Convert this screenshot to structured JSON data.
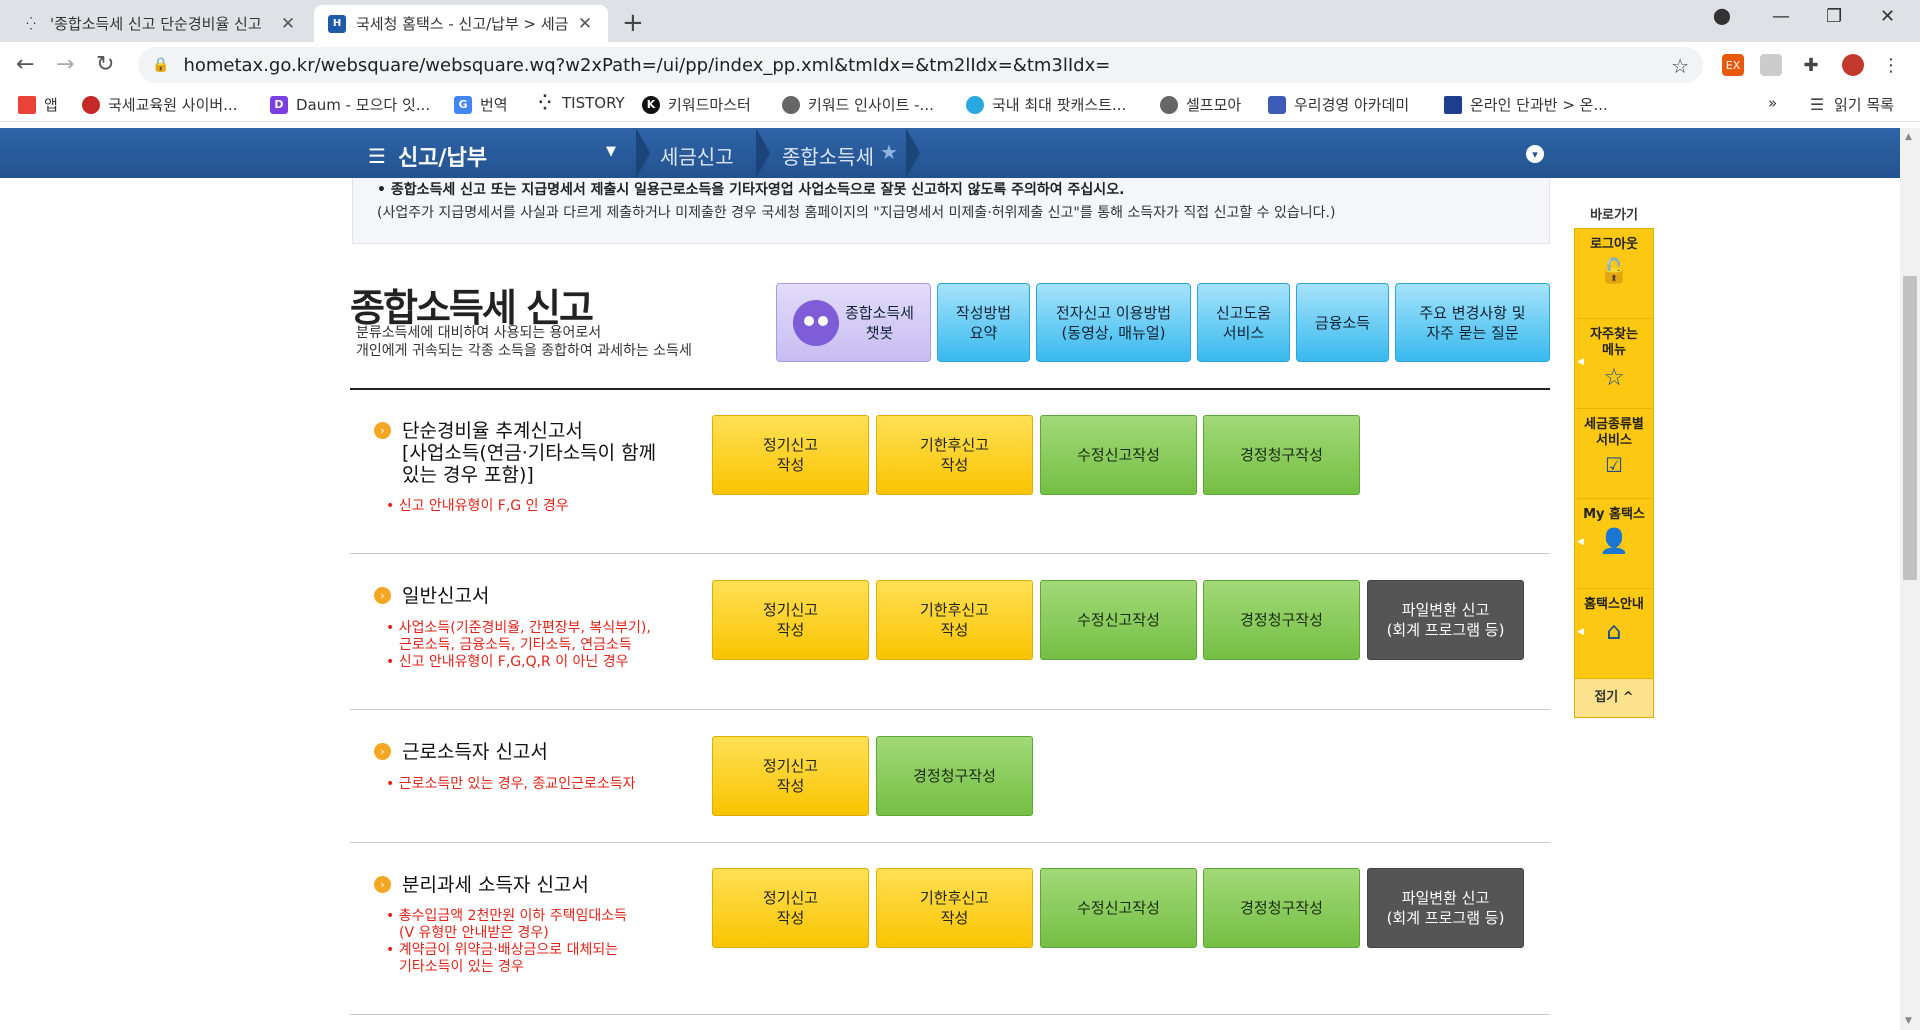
{
  "browser": {
    "tabs": [
      {
        "title": "'종합소득세 신고 단순경비율 신고",
        "active": false
      },
      {
        "title": "국세청 홈택스 - 신고/납부 > 세금",
        "active": true
      }
    ],
    "new_tab": "+",
    "url": "hometax.go.kr/websquare/websquare.wq?w2xPath=/ui/pp/index_pp.xml&tmIdx=&tm2lIdx=&tm3lIdx=",
    "bookmarks": [
      {
        "label": "앱"
      },
      {
        "label": "국세교육원 사이버..."
      },
      {
        "label": "Daum - 모으다 잇..."
      },
      {
        "label": "번역"
      },
      {
        "label": "TISTORY"
      },
      {
        "label": "키워드마스터"
      },
      {
        "label": "키워드 인사이트 -..."
      },
      {
        "label": "국내 최대 팟캐스트..."
      },
      {
        "label": "셀프모아"
      },
      {
        "label": "우리경영 아카데미"
      },
      {
        "label": "온라인 단과반 > 온..."
      }
    ],
    "more": "»",
    "reading_list": "읽기 목록"
  },
  "nav": {
    "menu": "신고/납부",
    "crumbs": [
      "세금신고",
      "종합소득세"
    ]
  },
  "notice": {
    "line1": "• 종합소득세 신고 또는 지급명세서 제출시 일용근로소득을 기타자영업 사업소득으로 잘못 신고하지 않도록 주의하여 주십시오.",
    "line2": "(사업주가 지급명세서를 사실과 다르게 제출하거나 미제출한 경우 국세청 홈페이지의 \"지급명세서 미제출·허위제출 신고\"를 통해 소득자가 직접 신고할 수 있습니다.)"
  },
  "header": {
    "title": "종합소득세 신고",
    "desc1": "분류소득세에 대비하여 사용되는 용어로서",
    "desc2": "개인에게 귀속되는 각종 소득을 종합하여 과세하는 소득세",
    "buttons": {
      "chatbot1": "종합소득세",
      "chatbot2": "챗봇",
      "guide1": "작성방법",
      "guide2": "요약",
      "efile1": "전자신고 이용방법",
      "efile2": "(동영상, 매뉴얼)",
      "help1": "신고도움",
      "help2": "서비스",
      "finance": "금융소득",
      "faq1": "주요 변경사항 및",
      "faq2": "자주 묻는 질문"
    }
  },
  "sections": [
    {
      "title1": "단순경비율 추계신고서",
      "title2": "[사업소득(연금·기타소득이 함께",
      "title3": "있는 경우 포함)]",
      "note1": "• 신고 안내유형이 F,G 인 경우"
    },
    {
      "title1": "일반신고서",
      "note1": "• 사업소득(기준경비율, 간편장부, 복식부기),",
      "note2": "근로소득, 금융소득, 기타소득, 연금소득",
      "note3": "• 신고 안내유형이 F,G,Q,R 이 아닌 경우"
    },
    {
      "title1": "근로소득자 신고서",
      "note1": "• 근로소득만 있는 경우, 종교인근로소득자"
    },
    {
      "title1": "분리과세 소득자 신고서",
      "note1": "• 총수입금액 2천만원 이하 주택임대소득",
      "note2": "(V 유형만 안내받은 경우)",
      "note3": "• 계약금이 위약금·배상금으로 대체되는",
      "note4": "기타소득이 있는 경우"
    }
  ],
  "actions": {
    "regular1": "정기신고",
    "regular2": "작성",
    "late1": "기한후신고",
    "late2": "작성",
    "amend": "수정신고작성",
    "refund": "경정청구작성",
    "file1": "파일변환 신고",
    "file2": "(회계 프로그램 등)"
  },
  "quick": {
    "head": "바로가기",
    "logout": "로그아웃",
    "freq1": "자주찾는",
    "freq2": "메뉴",
    "tax1": "세금종류별",
    "tax2": "서비스",
    "my": "My 홈택스",
    "guide": "홈택스안내",
    "fold": "접기 ^"
  },
  "colors": {
    "nav_blue": "#2f64a8",
    "yellow_button": "#f9c400",
    "green_button": "#74bf45",
    "gray_button": "#555555",
    "note_red": "#e2231a",
    "quick_yellow": "#fcc812"
  }
}
